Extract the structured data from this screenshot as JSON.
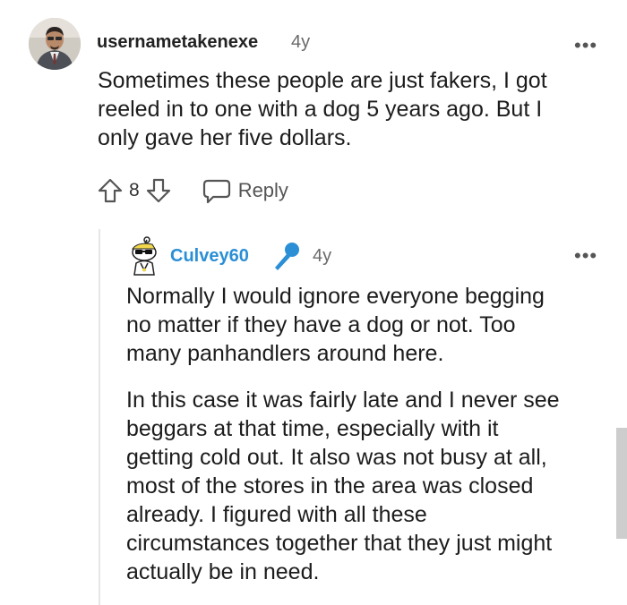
{
  "comment": {
    "author": "usernametakenexe",
    "age": "4y",
    "more_label": "•••",
    "body_lines": [
      "Sometimes these people are just fakers, I got",
      "reeled in to one with a dog 5 years ago. But I",
      "only gave her five dollars."
    ],
    "vote_count": "8",
    "reply_label": "Reply"
  },
  "reply": {
    "author": "Culvey60",
    "age": "4y",
    "more_label": "•••",
    "paragraph1_lines": [
      "Normally I would ignore everyone begging",
      "no matter if they have a dog or not. Too",
      "many panhandlers around here."
    ],
    "paragraph2_lines": [
      "In this case it was fairly late and I never see",
      "beggars at that time, especially with it",
      "getting cold out. It also was not busy at all,",
      "most of the stores in the area was closed",
      "already. I figured with all these",
      "circumstances together that they just might",
      "actually be in need."
    ]
  },
  "colors": {
    "author_flair": "#2b8fd6",
    "mic_icon": "#2b8fd6",
    "scrollbar": "#cdcdcd"
  },
  "icons": [
    "avatar-photo",
    "upvote-icon",
    "downvote-icon",
    "reply-bubble-icon",
    "snoo-avatar",
    "microphone-icon",
    "more-options-icon"
  ]
}
